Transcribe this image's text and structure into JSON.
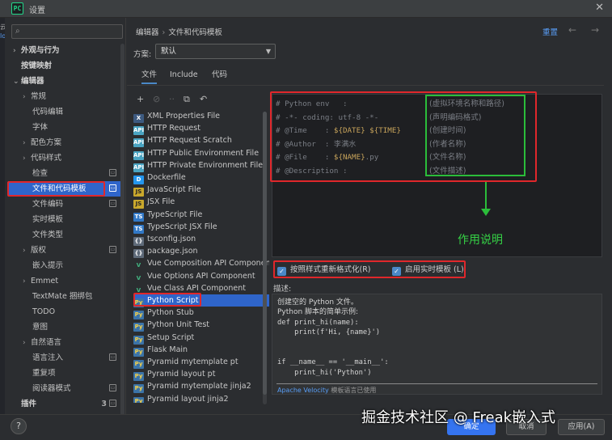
{
  "window": {
    "title": "设置",
    "app_icon": "PC",
    "close": "✕"
  },
  "left_edge": {
    "frag1": "云",
    "frag2": "lo"
  },
  "sidebar": {
    "search_placeholder": "",
    "items": [
      {
        "label": "外观与行为",
        "arrow": "›"
      },
      {
        "label": "按键映射",
        "arrow": ""
      },
      {
        "label": "编辑器",
        "arrow": "⌄"
      },
      {
        "label": "常规",
        "arrow": "›"
      },
      {
        "label": "代码编辑",
        "arrow": ""
      },
      {
        "label": "字体",
        "arrow": ""
      },
      {
        "label": "配色方案",
        "arrow": "›"
      },
      {
        "label": "代码样式",
        "arrow": "›"
      },
      {
        "label": "检查",
        "arrow": ""
      },
      {
        "label": "文件和代码模板",
        "arrow": ""
      },
      {
        "label": "文件编码",
        "arrow": ""
      },
      {
        "label": "实时模板",
        "arrow": ""
      },
      {
        "label": "文件类型",
        "arrow": ""
      },
      {
        "label": "版权",
        "arrow": "›"
      },
      {
        "label": "嵌入提示",
        "arrow": ""
      },
      {
        "label": "Emmet",
        "arrow": "›"
      },
      {
        "label": "TextMate 捆绑包",
        "arrow": ""
      },
      {
        "label": "TODO",
        "arrow": ""
      },
      {
        "label": "意图",
        "arrow": ""
      },
      {
        "label": "自然语言",
        "arrow": "›"
      },
      {
        "label": "语言注入",
        "arrow": ""
      },
      {
        "label": "重复项",
        "arrow": ""
      },
      {
        "label": "阅读器模式",
        "arrow": ""
      },
      {
        "label": "插件",
        "arrow": "",
        "count": "3"
      }
    ]
  },
  "header": {
    "breadcrumb_parent": "编辑器",
    "breadcrumb_sep": "›",
    "breadcrumb_current": "文件和代码模板",
    "reset": "重置",
    "back": "←",
    "forward": "→"
  },
  "scheme": {
    "label": "方案:",
    "value": "默认",
    "chevron": "▼"
  },
  "tabs": [
    "文件",
    "Include",
    "代码"
  ],
  "toolbar": {
    "add": "+",
    "copy": "⧉",
    "reset": "↶"
  },
  "templates": [
    {
      "label": "XML Properties File",
      "icon": "xml"
    },
    {
      "label": "HTTP Request",
      "icon": "http"
    },
    {
      "label": "HTTP Request Scratch",
      "icon": "http"
    },
    {
      "label": "HTTP Public Environment File",
      "icon": "http"
    },
    {
      "label": "HTTP Private Environment File",
      "icon": "http"
    },
    {
      "label": "Dockerfile",
      "icon": "docker"
    },
    {
      "label": "JavaScript File",
      "icon": "js"
    },
    {
      "label": "JSX File",
      "icon": "js"
    },
    {
      "label": "TypeScript File",
      "icon": "ts"
    },
    {
      "label": "TypeScript JSX File",
      "icon": "ts"
    },
    {
      "label": "tsconfig.json",
      "icon": "json"
    },
    {
      "label": "package.json",
      "icon": "json"
    },
    {
      "label": "Vue Composition API Component",
      "icon": "vue"
    },
    {
      "label": "Vue Options API Component",
      "icon": "vue"
    },
    {
      "label": "Vue Class API Component",
      "icon": "vue"
    },
    {
      "label": "Python Script",
      "icon": "py"
    },
    {
      "label": "Python Stub",
      "icon": "py"
    },
    {
      "label": "Python Unit Test",
      "icon": "py"
    },
    {
      "label": "Setup Script",
      "icon": "py"
    },
    {
      "label": "Flask Main",
      "icon": "py"
    },
    {
      "label": "Pyramid mytemplate pt",
      "icon": "py"
    },
    {
      "label": "Pyramid layout pt",
      "icon": "py"
    },
    {
      "label": "Pyramid mytemplate jinja2",
      "icon": "py"
    },
    {
      "label": "Pyramid layout jinja2",
      "icon": "py"
    }
  ],
  "editor": {
    "lines": [
      {
        "text": "# Python env   :",
        "note": "(虚拟环境名称和路径)"
      },
      {
        "text": "# -*- coding: utf-8 -*-",
        "note": "(声明编码格式)"
      },
      {
        "pre": "# @Time    : ",
        "var": "${DATE} ${TIME}",
        "note": "(创建时间)"
      },
      {
        "text": "# @Author  : 李满水",
        "note": "(作者名称)"
      },
      {
        "pre": "# @File    : ",
        "var": "${NAME}",
        "post": ".py",
        "note": "(文件名称)"
      },
      {
        "text": "# @Description :",
        "note": "(文件描述)"
      }
    ],
    "annotation": "作用说明"
  },
  "options": {
    "reformat": "按照样式重新格式化(R)",
    "live_templates": "启用实时模板 (L)",
    "check": "✓"
  },
  "description": {
    "label": "描述:",
    "lines": [
      "创建空的 Python 文件。",
      "Python 脚本的简单示例:",
      "def print_hi(name):",
      "    print(f'Hi, {name}')",
      "",
      "",
      "if __name__ == '__main__':",
      "    print_hi('Python')"
    ],
    "footer_link": "Apache Velocity",
    "footer_text": " 模板语言已使用"
  },
  "footer": {
    "help": "?",
    "ok": "确定",
    "cancel": "取消",
    "apply": "应用(A)"
  },
  "watermark": "掘金技术社区 @ Freak嵌入式",
  "colors": {
    "accent": "#3574f0",
    "selection": "#2f65ca",
    "highlight_red": "#e0272b",
    "highlight_green": "#2bbd3a"
  }
}
